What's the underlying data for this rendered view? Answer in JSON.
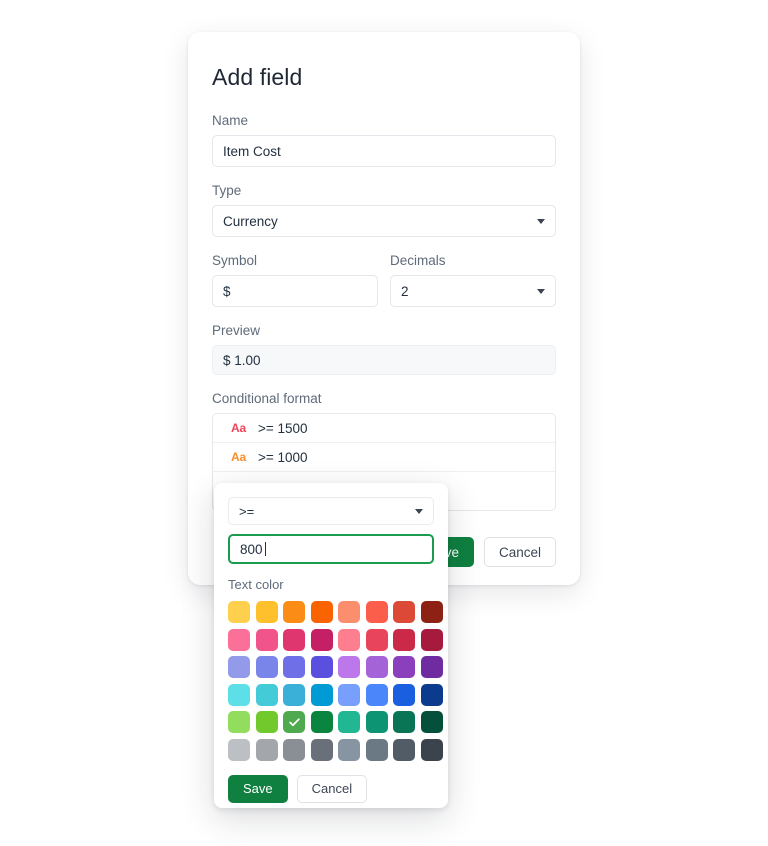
{
  "card": {
    "title": "Add field",
    "fields": {
      "name": {
        "label": "Name",
        "value": "Item Cost"
      },
      "type": {
        "label": "Type",
        "value": "Currency"
      },
      "symbol": {
        "label": "Symbol",
        "value": "$"
      },
      "decimals": {
        "label": "Decimals",
        "value": "2"
      },
      "preview": {
        "label": "Preview",
        "value": "$ 1.00"
      },
      "conditional_format": {
        "label": "Conditional format"
      }
    },
    "conditional_rules": [
      {
        "icon": "Aa",
        "icon_color": "#f0445a",
        "text": ">= 1500"
      },
      {
        "icon": "Aa",
        "icon_color": "#f5902a",
        "text": ">= 1000"
      }
    ],
    "actions": {
      "save": "Save",
      "cancel": "Cancel"
    }
  },
  "popover": {
    "operator": {
      "value": ">="
    },
    "threshold": {
      "value": "800"
    },
    "color_label": "Text color",
    "selected_swatch_index": 34,
    "swatches": [
      "#ffd04d",
      "#ffc02e",
      "#fb8c15",
      "#fa6400",
      "#fb8e6d",
      "#fb5f4b",
      "#dc4a37",
      "#8c2114",
      "#fb7098",
      "#f0548b",
      "#e03670",
      "#c51f66",
      "#fd7e8e",
      "#e8445b",
      "#ca2a48",
      "#a61b3d",
      "#949aea",
      "#7a85ea",
      "#6f70e8",
      "#5b4fe0",
      "#bc78ea",
      "#a563d8",
      "#8b3fbd",
      "#6e2ca0",
      "#5ddfe8",
      "#43ccd8",
      "#3ab0d8",
      "#009bd4",
      "#789ffb",
      "#4b86fb",
      "#1a5fe0",
      "#0c3a8c",
      "#92dc5e",
      "#72c92c",
      "#4fa94f",
      "#0a8540",
      "#22b793",
      "#0d9473",
      "#0a7554",
      "#05503a",
      "#bcc0c4",
      "#a3a7ab",
      "#8a8f95",
      "#6a7079",
      "#8795a3",
      "#6b7985",
      "#515c66",
      "#3b434c"
    ],
    "actions": {
      "save": "Save",
      "cancel": "Cancel"
    }
  }
}
